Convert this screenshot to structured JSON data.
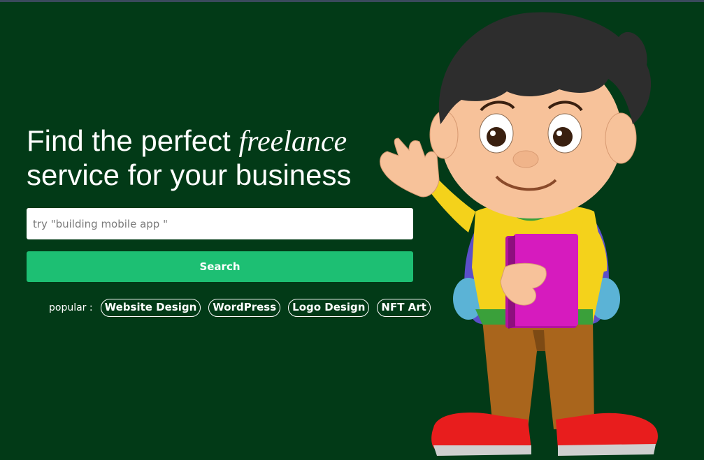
{
  "hero": {
    "headline_line1": "Find the perfect ",
    "headline_emphasis": "freelance",
    "headline_line2": "service for your business"
  },
  "search": {
    "placeholder": "try \"building mobile app \"",
    "value": "",
    "button_label": "Search"
  },
  "popular": {
    "label": "popular :",
    "tags": [
      "Website Design",
      "WordPress",
      "Logo Design",
      "NFT Art"
    ]
  },
  "illustration": {
    "icon": "cartoon-boy-with-book-illustration"
  },
  "colors": {
    "background": "#023a17",
    "accent": "#1dbf73",
    "text": "#ffffff"
  }
}
